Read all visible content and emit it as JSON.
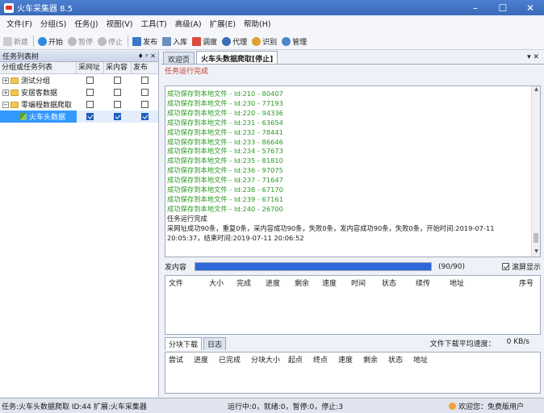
{
  "window": {
    "title": "火车采集器 8.5"
  },
  "menu": [
    "文件(F)",
    "分组(S)",
    "任务(J)",
    "视图(V)",
    "工具(T)",
    "高级(A)",
    "扩展(E)",
    "帮助(H)"
  ],
  "toolbar": {
    "new_label": "新建",
    "start_label": "开始",
    "pause_label": "暂停",
    "stop_label": "停止",
    "publish_label": "发布",
    "import_label": "入库",
    "schedule_label": "调度",
    "proxy_label": "代理",
    "recognize_label": "识别",
    "manage_label": "管理"
  },
  "left_panel": {
    "title": "任务列表树",
    "pin_glyph": "♦ ᵖ ✕",
    "columns": [
      "分组或任务列表",
      "采网址",
      "采内容",
      "发布"
    ],
    "rows": [
      {
        "name": "测试分组",
        "expander": "+",
        "checks": [
          false,
          false,
          false
        ]
      },
      {
        "name": "安居客数据",
        "expander": "+",
        "checks": [
          false,
          false,
          false
        ]
      },
      {
        "name": "零编程数据爬取",
        "expander": "−",
        "checks": [
          false,
          false,
          false
        ]
      },
      {
        "name": "火车头数据",
        "expander": "",
        "checks": [
          true,
          true,
          true
        ]
      }
    ]
  },
  "tabs": [
    {
      "label": "欢迎页"
    },
    {
      "label": "火车头数据爬取[停止]"
    }
  ],
  "tab_ctrl": "▾ ✕",
  "task_status": "任务运行完成",
  "log": {
    "ok_lines": [
      "成功保存到本地文件 - Id:210 - 80407",
      "成功保存到本地文件 - Id:230 - 77193",
      "成功保存到本地文件 - Id:220 - 94336",
      "成功保存到本地文件 - Id:231 - 63654",
      "成功保存到本地文件 - Id:232 - 78441",
      "成功保存到本地文件 - Id:233 - 86646",
      "成功保存到本地文件 - Id:234 - 57673",
      "成功保存到本地文件 - Id:235 - 81810",
      "成功保存到本地文件 - Id:236 - 97075",
      "成功保存到本地文件 - Id:237 - 71647",
      "成功保存到本地文件 - Id:238 - 67170",
      "成功保存到本地文件 - Id:239 - 67161",
      "成功保存到本地文件 - Id:240 - 26700"
    ],
    "summary_lines": [
      "任务运行完成",
      "采网址成功90条，重复0条，采内容成功90条，失败0条，发内容成功90条，失败0条，开始时间:2019-07-11",
      "20:05:37，结束时间:2019-07-11  20:06:52"
    ]
  },
  "progress": {
    "label": "发内容",
    "count": "(90/90)",
    "fraction": 1.0,
    "scroll_label": "滚屏显示"
  },
  "download_table": {
    "columns": [
      "文件",
      "大小",
      "完成",
      "进度",
      "剩余",
      "速度",
      "时间",
      "状态",
      "续传",
      "地址",
      "序号"
    ]
  },
  "subtabs": [
    "分块下载",
    "日志"
  ],
  "speed": {
    "label": "文件下载平均速度：",
    "value": "0 KB/s"
  },
  "chunk_table": {
    "columns": [
      "尝试",
      "进度",
      "已完成",
      "分块大小",
      "起点",
      "终点",
      "速度",
      "剩余",
      "状态",
      "地址"
    ]
  },
  "statusbar": {
    "task": "任务:火车头数据爬取  ID:44  扩展:火车采集器",
    "counts": "运行中:0，就绪:0，暂停:0，停止:3",
    "user": "欢迎您：免费版用户"
  },
  "colors": {
    "accent": "#2f67d8",
    "log_ok": "#2d9a27",
    "status": "#c03a2b"
  }
}
